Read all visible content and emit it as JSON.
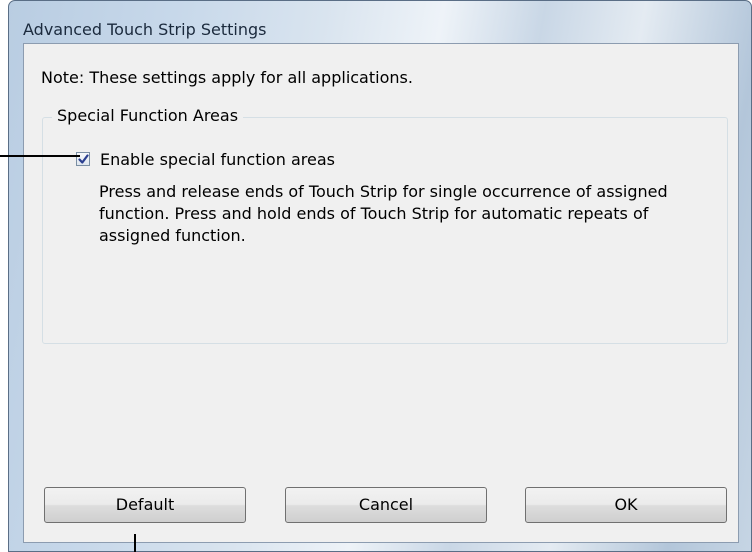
{
  "window": {
    "title": "Advanced Touch Strip Settings"
  },
  "note": "Note: These settings apply for all applications.",
  "group": {
    "legend": "Special Function Areas",
    "checkbox": {
      "label": "Enable special function areas",
      "checked": true
    },
    "description": "Press and release ends of Touch Strip for single occurrence of assigned function. Press and hold ends of Touch Strip for automatic repeats of assigned function."
  },
  "buttons": {
    "default_label": "Default",
    "cancel_label": "Cancel",
    "ok_label": "OK"
  },
  "icons": {
    "checkmark": "checkmark-icon"
  },
  "colors": {
    "client_background": "#f0f0f0",
    "checkmark": "#2b3f8f",
    "callout_line": "#000000"
  }
}
